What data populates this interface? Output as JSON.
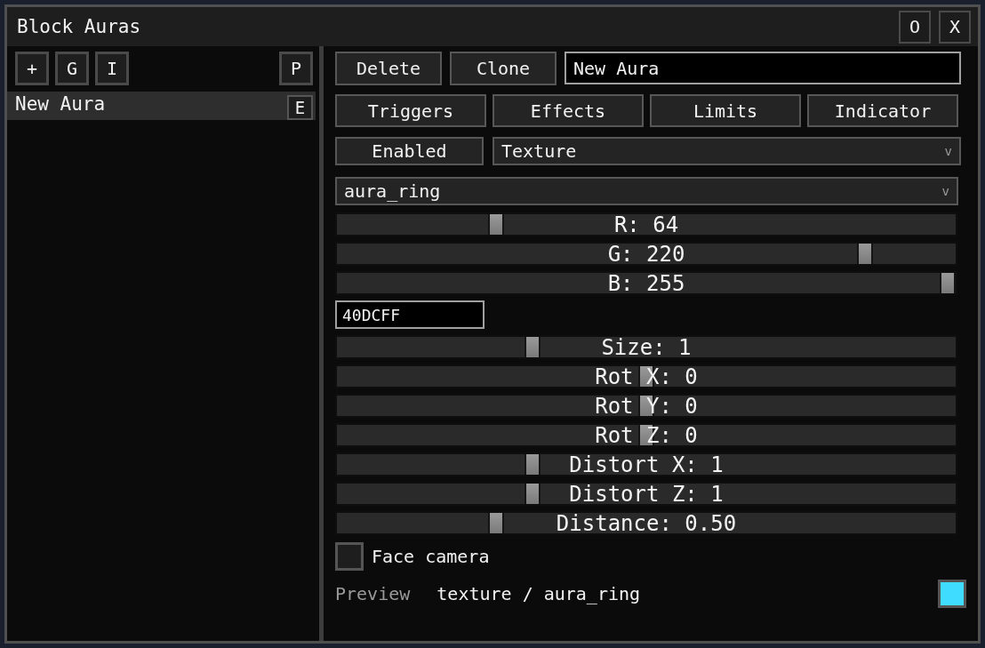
{
  "window": {
    "title": "Block Auras",
    "buttons": [
      {
        "label": "O"
      },
      {
        "label": "X"
      }
    ]
  },
  "sidebar": {
    "toolbar_left": [
      "+",
      "G",
      "I"
    ],
    "toolbar_right": [
      "P"
    ],
    "items": [
      {
        "name": "New Aura",
        "selected": true,
        "button": "E"
      }
    ]
  },
  "editor": {
    "actions": [
      "Delete",
      "Clone"
    ],
    "name_field": {
      "value": "New Aura"
    },
    "tabs": [
      {
        "label": "Triggers",
        "selected": false
      },
      {
        "label": "Effects",
        "selected": false
      },
      {
        "label": "Limits",
        "selected": false
      },
      {
        "label": "Indicator",
        "selected": false
      }
    ],
    "toggle": {
      "label": "Enabled"
    },
    "type_dropdown": {
      "value": "Texture",
      "arrow": "v"
    },
    "texture_dropdown": {
      "value": "aura_ring",
      "arrow": "v"
    },
    "color_sliders": [
      {
        "label": "R: 64",
        "level": 0.251
      },
      {
        "label": "G: 220",
        "level": 0.863
      },
      {
        "label": "B: 255",
        "level": 1
      }
    ],
    "hex_field": {
      "value": "40DCFF"
    },
    "sliders": [
      {
        "label": "Size: 1",
        "level": 0.311
      },
      {
        "label": "Rot X: 0",
        "level": 0.5
      },
      {
        "label": "Rot Y: 0",
        "level": 0.5
      },
      {
        "label": "Rot Z: 0",
        "level": 0.5
      },
      {
        "label": "Distort X: 1",
        "level": 0.311
      },
      {
        "label": "Distort Z: 1",
        "level": 0.311
      },
      {
        "label": "Distance: 0.50",
        "level": 0.25
      }
    ],
    "face_camera": {
      "label": "Face camera",
      "checked": false
    },
    "preview": {
      "label": "Preview",
      "value": "texture / aura_ring",
      "color": "#40dcff"
    }
  }
}
